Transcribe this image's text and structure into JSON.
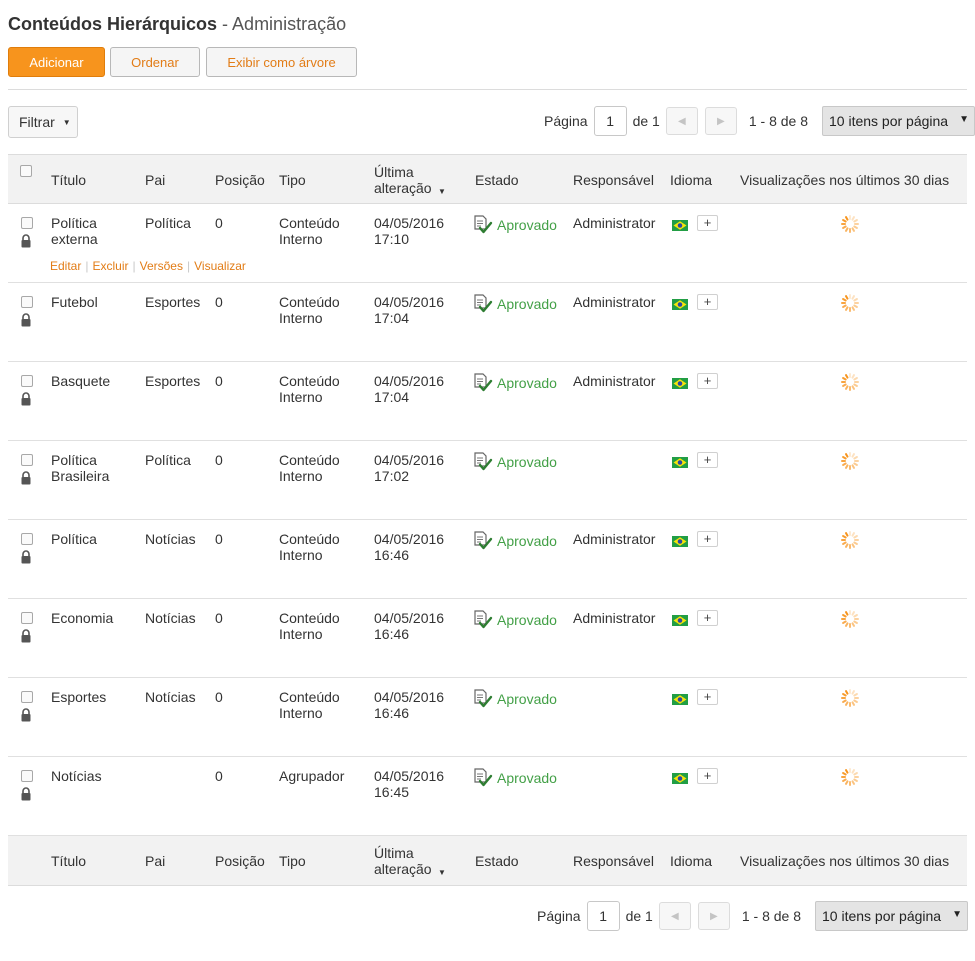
{
  "page": {
    "title": "Conteúdos Hierárquicos",
    "subtitle": "- Administração"
  },
  "toolbar": {
    "add_label": "Adicionar",
    "order_label": "Ordenar",
    "tree_label": "Exibir como árvore"
  },
  "filter": {
    "label": "Filtrar"
  },
  "pager": {
    "page_label": "Página",
    "current_page": "1",
    "of_label": "de 1",
    "range_label": "1 - 8 de 8",
    "per_page_label": "10 itens por página"
  },
  "columns": {
    "title": "Título",
    "parent": "Pai",
    "position": "Posição",
    "type": "Tipo",
    "modified_1": "Última",
    "modified_2": "alteração",
    "status": "Estado",
    "owner": "Responsável",
    "language": "Idioma",
    "views": "Visualizações nos últimos 30 dias"
  },
  "row_actions": {
    "edit": "Editar",
    "delete": "Excluir",
    "versions": "Versões",
    "view": "Visualizar"
  },
  "rows": [
    {
      "title": [
        "Política",
        "externa"
      ],
      "parent": "Política",
      "position": "0",
      "type": [
        "Conteúdo",
        "Interno"
      ],
      "date": "04/05/2016",
      "time": "17:10",
      "status": "Aprovado",
      "owner": "Administrator"
    },
    {
      "title": [
        "Futebol",
        ""
      ],
      "parent": "Esportes",
      "position": "0",
      "type": [
        "Conteúdo",
        "Interno"
      ],
      "date": "04/05/2016",
      "time": "17:04",
      "status": "Aprovado",
      "owner": "Administrator"
    },
    {
      "title": [
        "Basquete",
        ""
      ],
      "parent": "Esportes",
      "position": "0",
      "type": [
        "Conteúdo",
        "Interno"
      ],
      "date": "04/05/2016",
      "time": "17:04",
      "status": "Aprovado",
      "owner": "Administrator"
    },
    {
      "title": [
        "Política",
        "Brasileira"
      ],
      "parent": "Política",
      "position": "0",
      "type": [
        "Conteúdo",
        "Interno"
      ],
      "date": "04/05/2016",
      "time": "17:02",
      "status": "Aprovado",
      "owner": ""
    },
    {
      "title": [
        "Política",
        ""
      ],
      "parent": "Notícias",
      "position": "0",
      "type": [
        "Conteúdo",
        "Interno"
      ],
      "date": "04/05/2016",
      "time": "16:46",
      "status": "Aprovado",
      "owner": "Administrator"
    },
    {
      "title": [
        "Economia",
        ""
      ],
      "parent": "Notícias",
      "position": "0",
      "type": [
        "Conteúdo",
        "Interno"
      ],
      "date": "04/05/2016",
      "time": "16:46",
      "status": "Aprovado",
      "owner": "Administrator"
    },
    {
      "title": [
        "Esportes",
        ""
      ],
      "parent": "Notícias",
      "position": "0",
      "type": [
        "Conteúdo",
        "Interno"
      ],
      "date": "04/05/2016",
      "time": "16:46",
      "status": "Aprovado",
      "owner": ""
    },
    {
      "title": [
        "Notícias",
        ""
      ],
      "parent": "",
      "position": "0",
      "type": [
        "Agrupador",
        ""
      ],
      "date": "04/05/2016",
      "time": "16:45",
      "status": "Aprovado",
      "owner": ""
    }
  ],
  "icons": {
    "lock": "lock-icon",
    "status": "approved-document-icon",
    "flag": "brazil-flag-icon",
    "plus": "plus-icon",
    "spinner": "loading-spinner-icon",
    "prev": "chevron-left-icon",
    "next": "chevron-right-icon"
  },
  "colors": {
    "primary": "#f7941d",
    "link": "#e27c16",
    "approved": "#43a047"
  }
}
